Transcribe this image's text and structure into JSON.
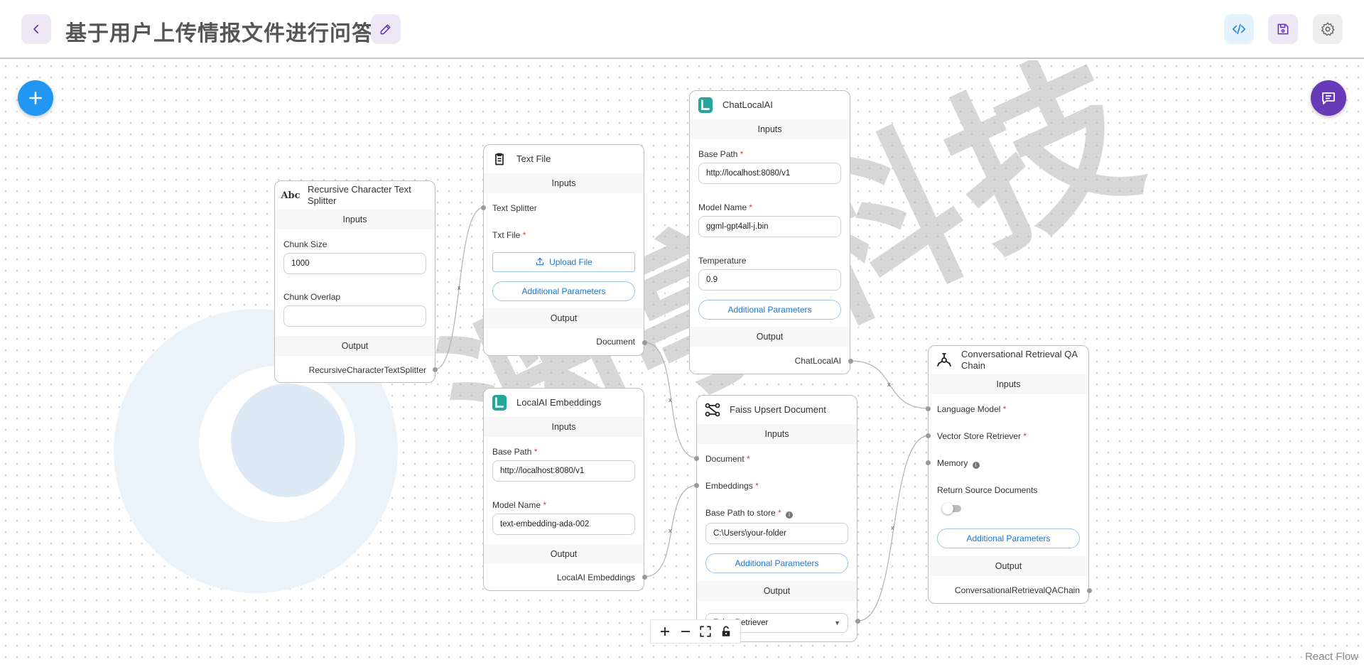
{
  "header": {
    "back_icon": "chevron-left-icon",
    "title": "基于用户上传情报文件进行问答",
    "edit_icon": "pencil-icon",
    "code_icon": "code-icon",
    "save_icon": "save-icon",
    "settings_icon": "gear-icon"
  },
  "canvas": {
    "add_icon": "plus-icon",
    "chat_icon": "chat-icon",
    "watermark_text": "渊亭科技",
    "attribution": "React Flow",
    "controls": [
      "zoom-in-icon",
      "zoom-out-icon",
      "fit-view-icon",
      "lock-icon"
    ]
  },
  "colors": {
    "accent": "#2196f3",
    "chat": "#673ab7",
    "header_btn_bg": "#ede7f6",
    "code_btn_bg": "#e3f2fd"
  },
  "nodes": {
    "splitter": {
      "title": "Recursive Character Text Splitter",
      "icon": "abc-text-icon",
      "inputs_label": "Inputs",
      "chunk_size_label": "Chunk Size",
      "chunk_size_value": "1000",
      "chunk_overlap_label": "Chunk Overlap",
      "chunk_overlap_value": "",
      "output_label": "Output",
      "output_value": "RecursiveCharacterTextSplitter"
    },
    "textfile": {
      "title": "Text File",
      "icon": "clipboard-icon",
      "inputs_label": "Inputs",
      "text_splitter_label": "Text Splitter",
      "txt_file_label": "Txt File",
      "upload_label": "Upload File",
      "additional_label": "Additional Parameters",
      "output_label": "Output",
      "output_value": "Document"
    },
    "chatlocal": {
      "title": "ChatLocalAI",
      "icon": "localai-logo-icon",
      "inputs_label": "Inputs",
      "base_path_label": "Base Path",
      "base_path_value": "http://localhost:8080/v1",
      "model_name_label": "Model Name",
      "model_name_value": "ggml-gpt4all-j.bin",
      "temperature_label": "Temperature",
      "temperature_value": "0.9",
      "additional_label": "Additional Parameters",
      "output_label": "Output",
      "output_value": "ChatLocalAI"
    },
    "embeddings": {
      "title": "LocalAI Embeddings",
      "icon": "localai-logo-icon",
      "inputs_label": "Inputs",
      "base_path_label": "Base Path",
      "base_path_value": "http://localhost:8080/v1",
      "model_name_label": "Model Name",
      "model_name_value": "text-embedding-ada-002",
      "output_label": "Output",
      "output_value": "LocalAI Embeddings"
    },
    "faiss": {
      "title": "Faiss Upsert Document",
      "icon": "network-nodes-icon",
      "inputs_label": "Inputs",
      "document_label": "Document",
      "embeddings_label": "Embeddings",
      "base_path_label": "Base Path to store",
      "base_path_value": "C:\\Users\\your-folder",
      "additional_label": "Additional Parameters",
      "output_label": "Output",
      "output_select_value": "Faiss Retriever"
    },
    "qa": {
      "title": "Conversational Retrieval QA Chain",
      "icon": "chain-nodes-icon",
      "inputs_label": "Inputs",
      "language_model_label": "Language Model",
      "vector_store_label": "Vector Store Retriever",
      "memory_label": "Memory",
      "return_source_label": "Return Source Documents",
      "return_source_enabled": false,
      "additional_label": "Additional Parameters",
      "output_label": "Output",
      "output_value": "ConversationalRetrievalQAChain"
    }
  },
  "edges": [
    {
      "from": "splitter.output",
      "to": "textfile.text_splitter"
    },
    {
      "from": "textfile.output",
      "to": "faiss.document"
    },
    {
      "from": "embeddings.output",
      "to": "faiss.embeddings"
    },
    {
      "from": "chatlocal.output",
      "to": "qa.language_model"
    },
    {
      "from": "faiss.output",
      "to": "qa.vector_store"
    }
  ],
  "edge_delete_label": "x",
  "required_mark": "*"
}
